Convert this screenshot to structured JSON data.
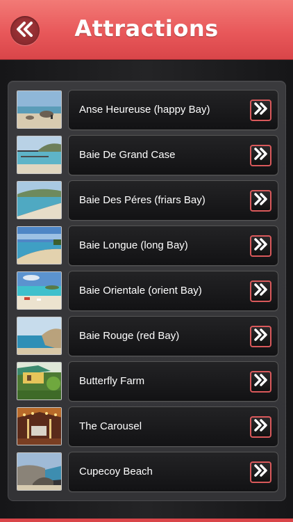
{
  "header": {
    "title": "Attractions",
    "back_icon": "double-chevron-left-icon",
    "colors": {
      "bar": "#e8585a",
      "back_button": "#8a2a2e"
    }
  },
  "attractions": [
    {
      "label": "Anse Heureuse (happy Bay)",
      "thumb": "beach-sand-rocks"
    },
    {
      "label": "Baie De Grand Case",
      "thumb": "bay-with-pier"
    },
    {
      "label": "Baie Des Péres (friars Bay)",
      "thumb": "curved-beach-hills"
    },
    {
      "label": "Baie Longue (long Bay)",
      "thumb": "long-sandy-beach"
    },
    {
      "label": "Baie Orientale (orient Bay)",
      "thumb": "turquoise-bay"
    },
    {
      "label": "Baie Rouge (red Bay)",
      "thumb": "red-cliffs-bay"
    },
    {
      "label": "Butterfly Farm",
      "thumb": "garden-building"
    },
    {
      "label": "The Carousel",
      "thumb": "carousel-lights"
    },
    {
      "label": "Cupecoy Beach",
      "thumb": "rock-formations-beach"
    }
  ],
  "row_icon": "double-chevron-right-icon",
  "accent_color": "#d9595b"
}
